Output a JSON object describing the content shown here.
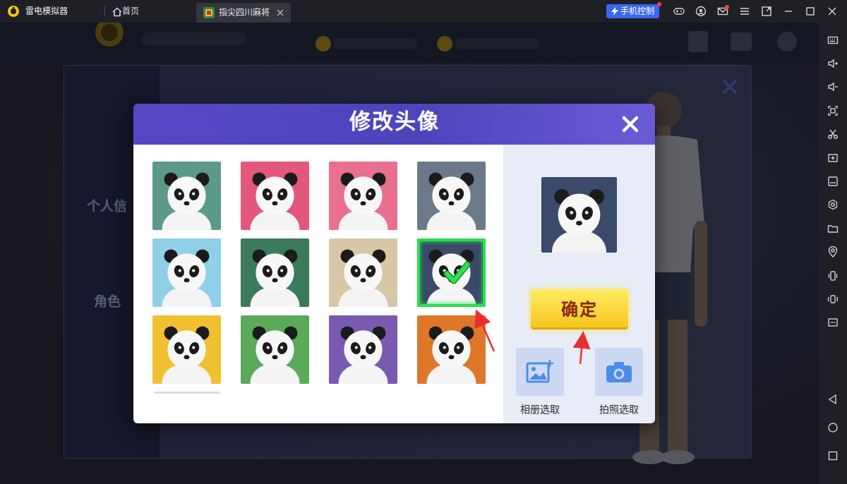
{
  "emulator": {
    "app_name": "雷电模拟器",
    "tabs": [
      {
        "label": "首页",
        "selected": false,
        "kind": "home"
      },
      {
        "label": "指尖四川麻将",
        "selected": true,
        "kind": "app"
      }
    ],
    "phone_control": {
      "label": "手机控制",
      "notify": true
    },
    "mail_notify": true
  },
  "background": {
    "menu_items": [
      "个人信",
      "角色"
    ]
  },
  "dialog": {
    "title": "修改头像",
    "avatars": [
      {
        "selected": false,
        "color": "#5b9a8b"
      },
      {
        "selected": false,
        "color": "#e3577d"
      },
      {
        "selected": false,
        "color": "#ea7090"
      },
      {
        "selected": false,
        "color": "#6a7a8a"
      },
      {
        "selected": false,
        "color": "#8fd0e8"
      },
      {
        "selected": false,
        "color": "#3b7a5a"
      },
      {
        "selected": false,
        "color": "#d8c8a8"
      },
      {
        "selected": true,
        "color": "#3a4a6a"
      },
      {
        "selected": false,
        "color": "#f0c030"
      },
      {
        "selected": false,
        "color": "#5aaa5a"
      },
      {
        "selected": false,
        "color": "#7a5ab0"
      },
      {
        "selected": false,
        "color": "#e0762a"
      }
    ],
    "confirm": "确定",
    "sources": [
      {
        "label": "相册选取",
        "kind": "album"
      },
      {
        "label": "拍照选取",
        "kind": "camera"
      }
    ]
  }
}
